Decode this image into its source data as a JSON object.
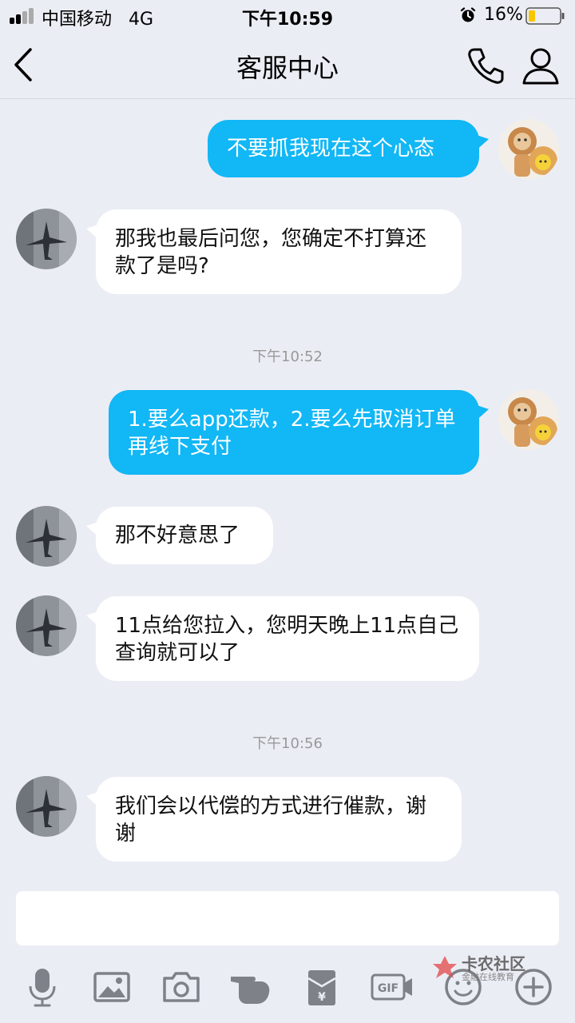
{
  "status_bar": {
    "carrier": "中国移动   4G",
    "time": "下午10:59",
    "battery": "16%",
    "icons": [
      "signal-icon",
      "alarm-icon",
      "battery-icon"
    ]
  },
  "header": {
    "title": "客服中心",
    "icons": [
      "back-arrow-icon",
      "phone-icon",
      "user-icon"
    ]
  },
  "messages": [
    {
      "from": "me",
      "text": "不要抓我现在这个心态"
    },
    {
      "from": "agent",
      "text": "那我也最后问您，您确定不打算还款了是吗?"
    },
    {
      "type": "time",
      "text": "下午10:52"
    },
    {
      "from": "me",
      "text": "1.要么app还款，2.要么先取消订单再线下支付"
    },
    {
      "from": "agent",
      "text": "那不好意思了"
    },
    {
      "from": "agent",
      "text": "11点给您拉入，您明天晚上11点自己查询就可以了"
    },
    {
      "type": "time",
      "text": "下午10:56"
    },
    {
      "from": "agent",
      "text": "我们会以代偿的方式进行催款，谢谢"
    }
  ],
  "input": {
    "value": "",
    "placeholder": ""
  },
  "toolbar": [
    "microphone-icon",
    "image-icon",
    "camera-icon",
    "poke-hand-icon",
    "red-packet-icon",
    "gif-icon",
    "emoji-icon",
    "plus-icon"
  ],
  "watermark": {
    "title": "卡农社区",
    "subtitle": "金融在线教育"
  },
  "colors": {
    "outgoing_bubble": "#12b7f5",
    "incoming_bubble": "#ffffff",
    "background": "#ebedf5"
  }
}
